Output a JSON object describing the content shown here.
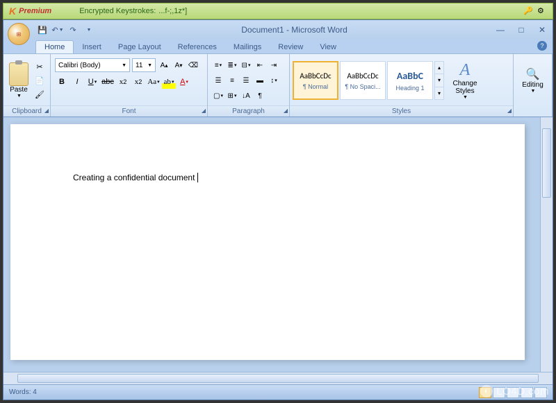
{
  "keyscrambler": {
    "logo": "K",
    "edition": "Premium",
    "label": "Encrypted Keystrokes:",
    "value": "...f-;,1z*]"
  },
  "window": {
    "title": "Document1 - Microsoft Word"
  },
  "tabs": [
    "Home",
    "Insert",
    "Page Layout",
    "References",
    "Mailings",
    "Review",
    "View"
  ],
  "ribbon": {
    "clipboard": {
      "label": "Clipboard",
      "paste": "Paste"
    },
    "font": {
      "label": "Font",
      "name": "Calibri (Body)",
      "size": "11"
    },
    "paragraph": {
      "label": "Paragraph"
    },
    "styles": {
      "label": "Styles",
      "items": [
        {
          "preview": "AaBbCcDc",
          "name": "¶ Normal"
        },
        {
          "preview": "AaBbCcDc",
          "name": "¶ No Spaci..."
        },
        {
          "preview": "AaBbC",
          "name": "Heading 1"
        }
      ],
      "change": "Change Styles"
    },
    "editing": {
      "label": "Editing"
    }
  },
  "document": {
    "text": "Creating a confidential document"
  },
  "status": {
    "words_label": "Words:",
    "words_count": "4"
  },
  "watermark": "LO4D.com"
}
